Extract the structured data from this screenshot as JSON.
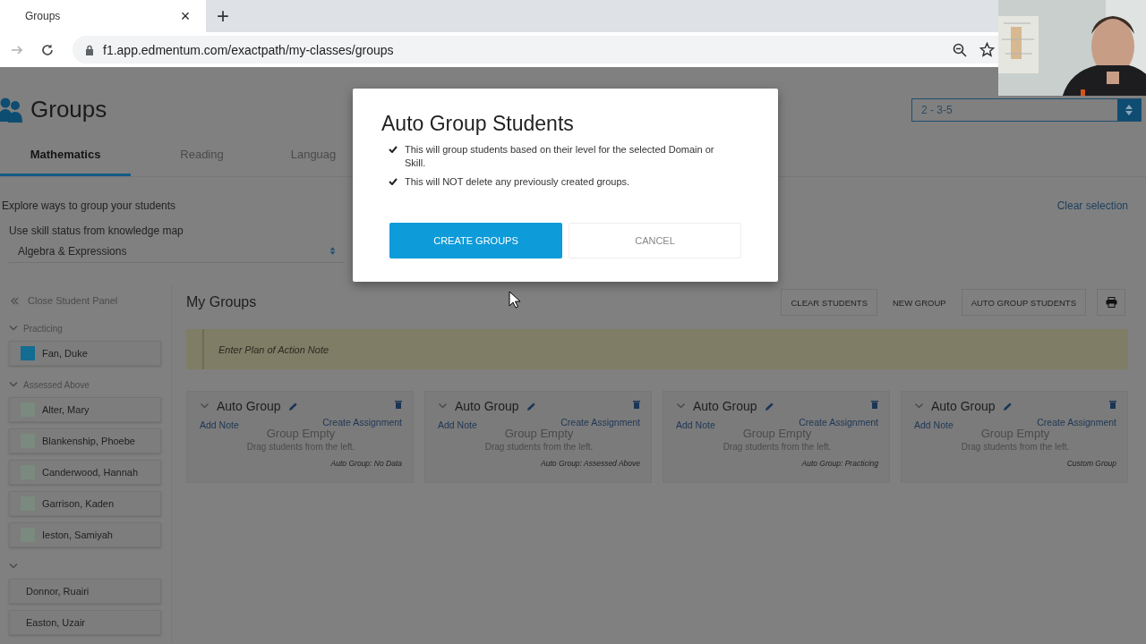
{
  "browser": {
    "tab_title": "Groups",
    "tab_close": "×",
    "new_tab": "+",
    "url": "f1.app.edmentum.com/exactpath/my-classes/groups"
  },
  "page": {
    "title": "Groups",
    "class_select": "2 - 3-5",
    "tabs": [
      {
        "label": "Mathematics",
        "selected": true
      },
      {
        "label": "Reading",
        "selected": false
      },
      {
        "label": "Languag",
        "selected": false
      }
    ],
    "explore": "Explore ways to group your students",
    "clear_selection": "Clear selection",
    "skill_label": "Use skill status from knowledge map",
    "domain_select": "Algebra & Expressions"
  },
  "student_panel": {
    "close": "Close Student Panel",
    "sections": [
      {
        "label": "Practicing",
        "expanded": true,
        "students": [
          {
            "name": "Fan, Duke",
            "color": "#136c92"
          }
        ]
      },
      {
        "label": "Assessed Above",
        "expanded": true,
        "students": [
          {
            "name": "Alter, Mary",
            "color": "#7a8a7e"
          },
          {
            "name": "Blankenship, Phoebe",
            "color": "#7a8a7e"
          },
          {
            "name": "Canderwood, Hannah",
            "color": "#7a8a7e"
          },
          {
            "name": "Garrison, Kaden",
            "color": "#7a8a7e"
          },
          {
            "name": "Ieston, Samiyah",
            "color": "#7a8a7e"
          }
        ]
      },
      {
        "expanded": true,
        "students": [
          {
            "name": "Donnor, Ruairi"
          },
          {
            "name": "Easton, Uzair"
          }
        ]
      }
    ]
  },
  "groups_area": {
    "heading": "My Groups",
    "actions": [
      {
        "label": "CLEAR STUDENTS",
        "kind": "outlined"
      },
      {
        "label": "NEW GROUP",
        "kind": "plain"
      },
      {
        "label": "AUTO GROUP STUDENTS",
        "kind": "outlined"
      }
    ],
    "note_placeholder": "Enter Plan of Action Note",
    "groups": [
      {
        "name": "Auto Group",
        "add_note": "Add Note",
        "create": "Create Assignment",
        "empty": "Group Empty",
        "hint": "Drag students from the left.",
        "type": "Auto Group: No Data"
      },
      {
        "name": "Auto Group",
        "add_note": "Add Note",
        "create": "Create Assignment",
        "empty": "Group Empty",
        "hint": "Drag students from the left.",
        "type": "Auto Group: Assessed Above"
      },
      {
        "name": "Auto Group",
        "add_note": "Add Note",
        "create": "Create Assignment",
        "empty": "Group Empty",
        "hint": "Drag students from the left.",
        "type": "Auto Group: Practicing"
      },
      {
        "name": "Auto Group",
        "add_note": "Add Note",
        "create": "Create Assignment",
        "empty": "Group Empty",
        "hint": "Drag students from the left.",
        "type": "Custom Group"
      }
    ]
  },
  "modal": {
    "title": "Auto Group Students",
    "points": [
      "This will group students based on their level for the selected Domain or Skill.",
      "This will NOT delete any previously created groups."
    ],
    "buttons": [
      {
        "label": "CREATE GROUPS",
        "kind": "primary"
      },
      {
        "label": "CANCEL",
        "kind": "secondary"
      }
    ]
  }
}
